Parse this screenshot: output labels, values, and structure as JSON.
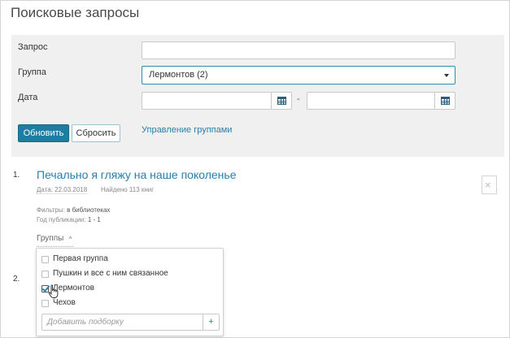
{
  "page": {
    "title": "Поисковые запросы"
  },
  "filters": {
    "query_label": "Запрос",
    "query_value": "",
    "group_label": "Группа",
    "group_selected": "Лермонтов (2)",
    "date_label": "Дата",
    "date_from": "",
    "date_to": "",
    "date_separator": "-",
    "update_button": "Обновить",
    "reset_button": "Сбросить",
    "manage_groups_link": "Управление группами"
  },
  "results": [
    {
      "number": "1.",
      "title": "Печально я гляжу на наше поколенье",
      "date": "Дата: 22.03.2018",
      "found": "Найдено 113 книг",
      "filters_label": "Фильтры:",
      "filters_value": "в библиотеках",
      "year_label": "Год публикации:",
      "year_value": "1 - 1",
      "groups_toggle": "Группы",
      "groups_chevron": "^"
    },
    {
      "number": "2."
    }
  ],
  "groups_dropdown": {
    "items": [
      {
        "label": "Первая группа",
        "checked": false
      },
      {
        "label": "Пушкин и все с ним связанное",
        "checked": false
      },
      {
        "label": "Лермонтов",
        "checked": true
      },
      {
        "label": "Чехов",
        "checked": false
      }
    ],
    "add_placeholder": "Добавить подборку",
    "add_button": "+"
  },
  "colors": {
    "accent": "#2a7ea8",
    "primary_button": "#1e7da3",
    "panel_background": "#f0f0f0"
  },
  "close_icon": "×"
}
